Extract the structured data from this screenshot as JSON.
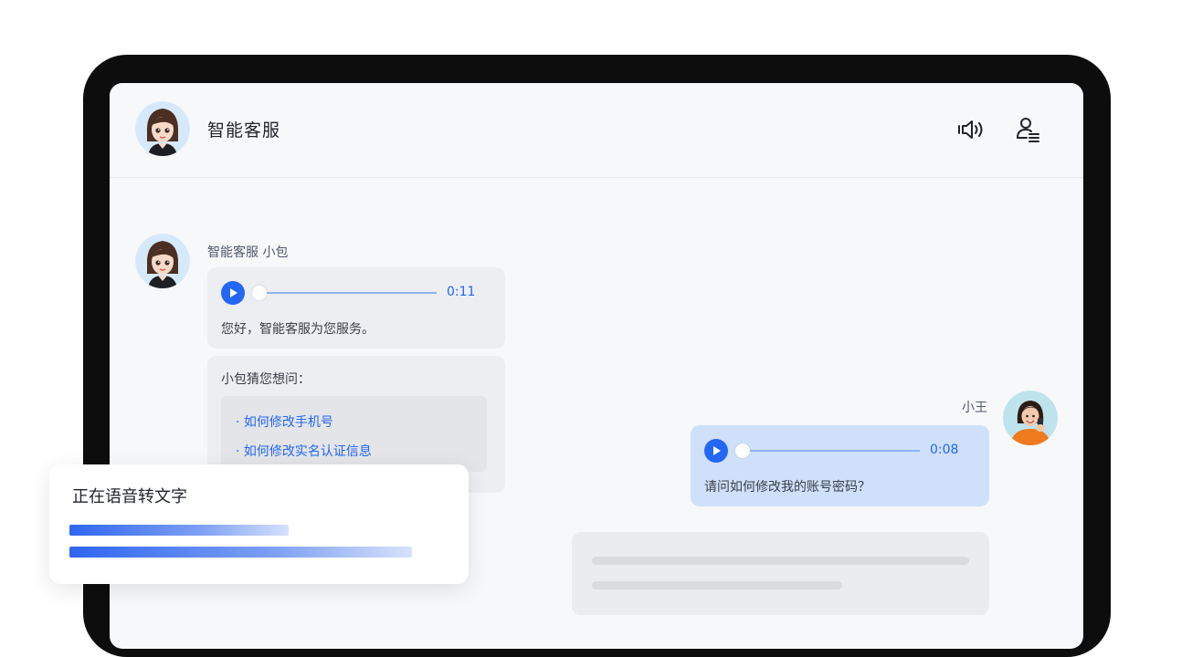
{
  "header": {
    "title": "智能客服",
    "speaker_icon": "speaker-icon",
    "user_list_icon": "user-list-icon"
  },
  "messages": {
    "bot": {
      "name": "智能客服 小包",
      "voice_duration": "0:11",
      "voice_text": "您好，智能客服为您服务。",
      "suggest_title": "小包猜您想问：",
      "suggestions": [
        "·  如何修改手机号",
        "·  如何修改实名认证信息"
      ]
    },
    "user": {
      "name": "小王",
      "voice_duration": "0:08",
      "voice_text": "请问如何修改我的账号密码？"
    }
  },
  "toast": {
    "title": "正在语音转文字",
    "progress_bars": [
      0.64,
      1.0
    ]
  },
  "colors": {
    "accent": "#2466f5",
    "user_bubble": "#cfe0fb",
    "bot_bubble": "#eceef1"
  }
}
